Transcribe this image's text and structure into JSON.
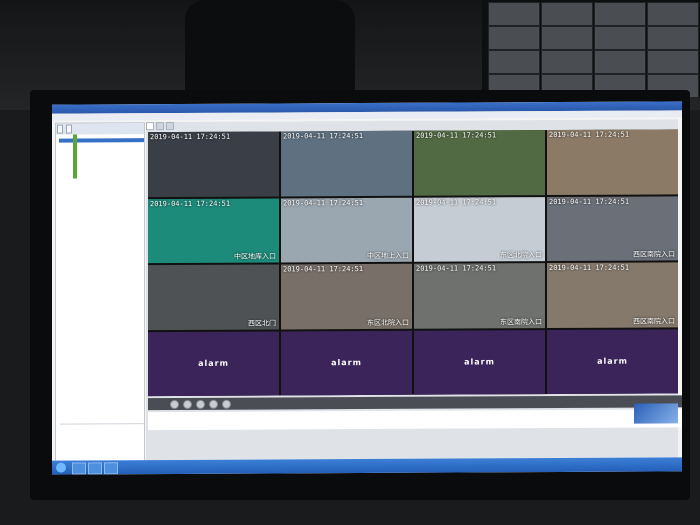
{
  "menu": [
    "",
    "",
    "",
    "",
    "",
    "",
    "",
    "",
    ""
  ],
  "tool_buttons": [
    "",
    ""
  ],
  "tree": {
    "root": "",
    "items": [
      "",
      "",
      "",
      "",
      "",
      "",
      "",
      "",
      "",
      "",
      ""
    ]
  },
  "tabs": [
    "",
    "",
    ""
  ],
  "cameras": [
    {
      "ts": "2019-04-11 17:24:51",
      "name": "",
      "bg": "#3a3f47"
    },
    {
      "ts": "2019-04-11 17:24:51",
      "name": "",
      "bg": "#5f7180"
    },
    {
      "ts": "2019-04-11 17:24:51",
      "name": "",
      "bg": "#526a44"
    },
    {
      "ts": "2019-04-11 17:24:51",
      "name": "",
      "bg": "#8a7a66"
    },
    {
      "ts": "2019-04-11 17:24:51",
      "name": "中区地库入口",
      "bg": "#1d8b7a"
    },
    {
      "ts": "2019-04-11 17:24:51",
      "name": "中区地上入口",
      "bg": "#9aa6b0"
    },
    {
      "ts": "2019-04-11 17:24:51",
      "name": "东区北院入口",
      "bg": "#c5ccd3"
    },
    {
      "ts": "2019-04-11 17:24:51",
      "name": "西区南院入口",
      "bg": "#6b7078"
    },
    {
      "ts": "",
      "name": "西区北门",
      "bg": "#4e5255"
    },
    {
      "ts": "2019-04-11 17:24:51",
      "name": "东区北院入口",
      "bg": "#787068"
    },
    {
      "ts": "2019-04-11 17:24:51",
      "name": "东区南院入口",
      "bg": "#6e716d"
    },
    {
      "ts": "2019-04-11 17:24:51",
      "name": "西区南院入口",
      "bg": "#85796c"
    }
  ],
  "alarm_label": "alarm",
  "status_fields": [
    "",
    "",
    "",
    "",
    "",
    "",
    "",
    ""
  ],
  "colors": {
    "alarm": "#3a2459",
    "accent": "#2a58aa"
  }
}
